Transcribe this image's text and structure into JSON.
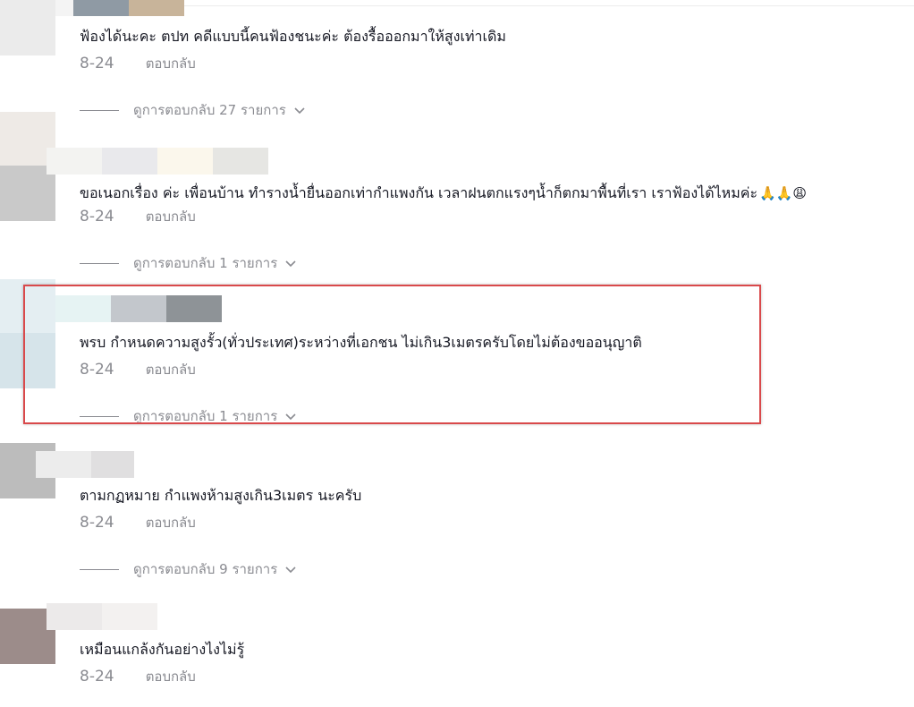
{
  "comments": [
    {
      "text": "ฟ้องได้นะคะ ตปท คดีแบบนี้คนฟ้องชนะค่ะ ต้องรื้อออกมาให้สูงเท่าเดิม",
      "date": "8-24",
      "reply_label": "ตอบกลับ",
      "view_replies_label": "ดูการตอบกลับ 27 รายการ"
    },
    {
      "text": "ขอเนอกเรื่อง ค่ะ เพื่อนบ้าน ทำรางน้ำยื่นออกเท่ากำแพงกัน เวลาฝนตกแรงๆน้ำก็ตกมาพื้นที่เรา เราฟ้องได้ไหมค่ะ",
      "emoji": "🙏🙏😩",
      "date": "8-24",
      "reply_label": "ตอบกลับ",
      "view_replies_label": "ดูการตอบกลับ 1 รายการ"
    },
    {
      "text": "พรบ กำหนดความสูงรั้ว(ทั่วประเทศ)ระหว่างที่เอกชน ไม่เกิน3เมตรครับโดยไม่ต้องขออนุญาติ",
      "date": "8-24",
      "reply_label": "ตอบกลับ",
      "view_replies_label": "ดูการตอบกลับ 1 รายการ"
    },
    {
      "text": "ตามกฏหมาย กำแพงห้ามสูงเกิน3เมตร นะครับ",
      "date": "8-24",
      "reply_label": "ตอบกลับ",
      "view_replies_label": "ดูการตอบกลับ 9 รายการ"
    },
    {
      "text": "เหมือนแกล้งกันอย่างไงไม่รู้",
      "date": "8-24",
      "reply_label": "ตอบกลับ"
    }
  ],
  "icons": {
    "chevron": "chevron-down-icon"
  },
  "colors": {
    "text": "#161823",
    "muted": "#8a8b91",
    "highlight_border": "#d9494b"
  }
}
